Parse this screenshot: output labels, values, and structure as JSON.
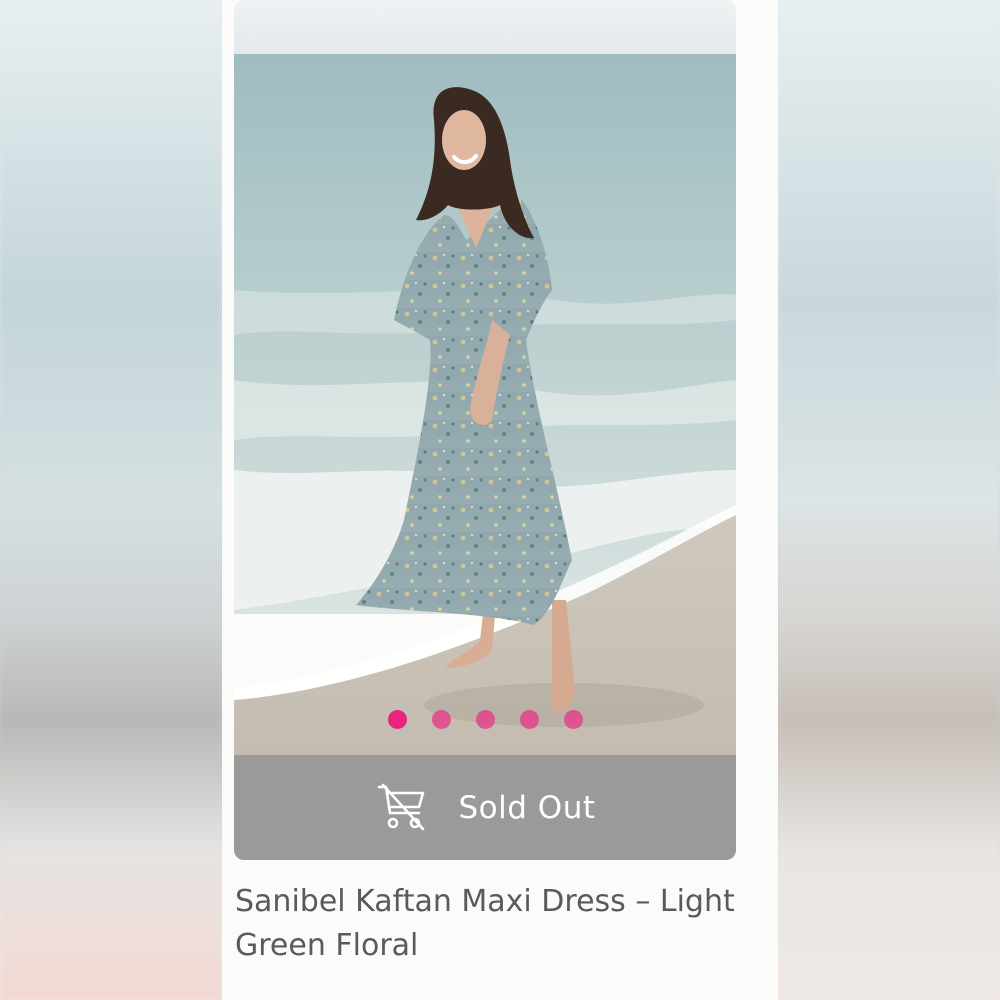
{
  "product": {
    "title": "Sanibel Kaftan Maxi Dress – Light Green Floral",
    "image_alt": "Woman in a light green floral kaftan maxi dress standing barefoot on a beach",
    "gallery": {
      "count": 5,
      "active_index": 0
    },
    "button": {
      "label": "Sold Out",
      "icon": "cart-disabled-icon"
    }
  },
  "colors": {
    "accent_dot": "#e8247e",
    "sold_out_bg": "#9a9a98",
    "title_text": "#5a5a5a"
  }
}
